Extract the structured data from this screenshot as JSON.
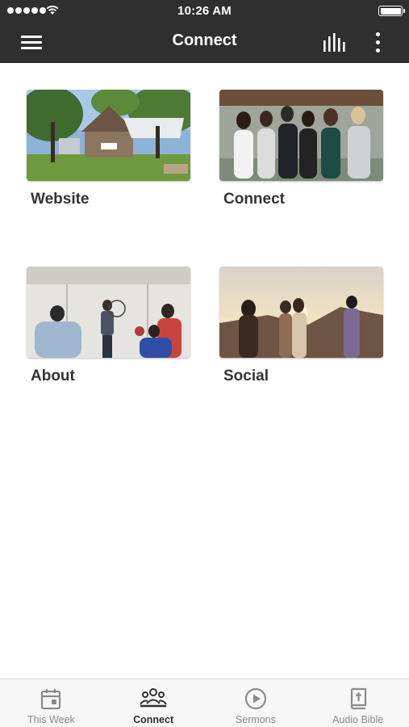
{
  "status_bar": {
    "time": "10:26 AM"
  },
  "nav": {
    "title": "Connect"
  },
  "tiles": [
    {
      "label": "Website"
    },
    {
      "label": "Connect"
    },
    {
      "label": "About"
    },
    {
      "label": "Social"
    }
  ],
  "tabs": [
    {
      "label": "This Week",
      "icon": "calendar-icon"
    },
    {
      "label": "Connect",
      "icon": "group-icon",
      "active": true
    },
    {
      "label": "Sermons",
      "icon": "play-circle-icon"
    },
    {
      "label": "Audio Bible",
      "icon": "bible-icon"
    }
  ],
  "colors": {
    "nav_bg": "#2f2f2f",
    "tab_active": "#2f2f2f",
    "tab_inactive": "#8a8a8a"
  }
}
